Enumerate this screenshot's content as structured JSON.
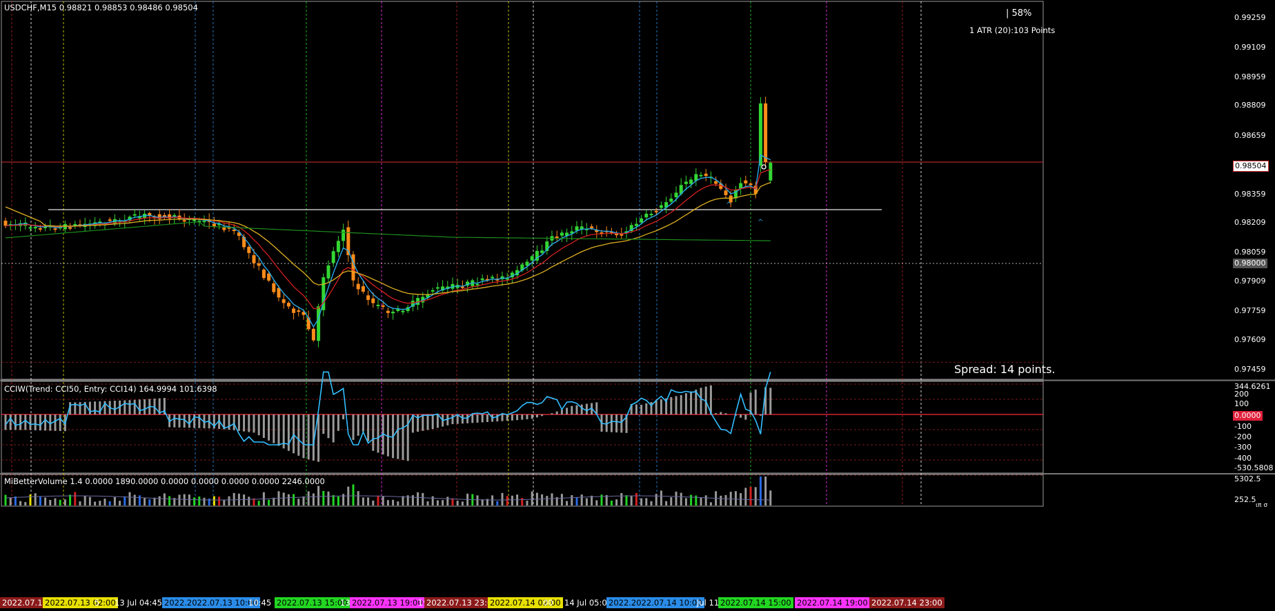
{
  "header": {
    "symbol_line": "USDCHF,M15  0.98821 0.98853 0.98486 0.98504",
    "percent": "|  58%",
    "atr": "1 ATR (20):103 Points",
    "spread": "Spread:  14 points."
  },
  "colors": {
    "bull": "#33d633",
    "bear": "#ff8c1a",
    "ma_fast": "#2aa8e8",
    "ma_mid": "#d62020",
    "ma_slow": "#e0b020",
    "ma_long": "#1e8c1e",
    "cci": "#33bfff",
    "zero_line": "#ff2a3a"
  },
  "price_axis": {
    "labels": [
      "0.99259",
      "0.99109",
      "0.98959",
      "0.98809",
      "0.98659",
      "0.98504",
      "0.98359",
      "0.98209",
      "0.98059",
      "0.98000",
      "0.97909",
      "0.97759",
      "0.97609",
      "0.97459"
    ],
    "current_price": "0.98504",
    "marked_level": "0.98000"
  },
  "cci_panel": {
    "label": "CCIW(Trend: CCI50, Entry: CCI14) 164.9994 101.6398",
    "axis": [
      "344.6261",
      "200",
      "100",
      "0.0000",
      "-100",
      "-200",
      "-300",
      "-400",
      "-530.5808"
    ]
  },
  "volume_panel": {
    "label": "MiBetterVolume 1.4 0.0000 1890.0000 0.0000 0.0000 0.0000 0.0000 2246.0000",
    "axis": [
      "5302.5",
      "252.5"
    ],
    "axis_cut": "ιπ σ"
  },
  "time_axis": [
    {
      "text": "2022.07.12 23:00",
      "bg": "#8b1a1a",
      "fg": "#ffffff"
    },
    {
      "text": "2022.07.13 02:00",
      "bg": "#e8e000",
      "fg": "#000000"
    },
    {
      "text": "5",
      "bg": "",
      "fg": "#ffffff"
    },
    {
      "text": "13 Jul 04:45",
      "bg": "",
      "fg": "#ffffff"
    },
    {
      "text": "2022.2022.07.13 10:00",
      "bg": "#2a8ce8",
      "fg": "#000000"
    },
    {
      "text": "10:45",
      "bg": "",
      "fg": "#ffffff"
    },
    {
      "text": "2022.07.13 15:00",
      "bg": "#22d622",
      "fg": "#000000"
    },
    {
      "text": "13",
      "bg": "",
      "fg": "#ffffff"
    },
    {
      "text": "2022.07.13 19:00",
      "bg": "#ff33ff",
      "fg": "#000000"
    },
    {
      "text": "19",
      "bg": "",
      "fg": "#ffffff"
    },
    {
      "text": "2022.07.13 23:00",
      "bg": "#8b1a1a",
      "fg": "#ffffff"
    },
    {
      "text": "2022.07.14 02:00",
      "bg": "#e8e000",
      "fg": "#000000"
    },
    {
      "text": "00",
      "bg": "",
      "fg": "#ffffff"
    },
    {
      "text": "14 Jul 05:00",
      "bg": "",
      "fg": "#ffffff"
    },
    {
      "text": "2022.2022.07.14 10:00",
      "bg": "#2a8ce8",
      "fg": "#000000"
    },
    {
      "text": "Jul 11:00",
      "bg": "",
      "fg": "#ffffff"
    },
    {
      "text": "2022.07.14 15:00",
      "bg": "#22d622",
      "fg": "#000000"
    },
    {
      "text": "2022.07.14 19:00",
      "bg": "#ff33ff",
      "fg": "#000000"
    },
    {
      "text": "2022.07.14 23:00",
      "bg": "#8b1a1a",
      "fg": "#ffffff"
    }
  ]
}
